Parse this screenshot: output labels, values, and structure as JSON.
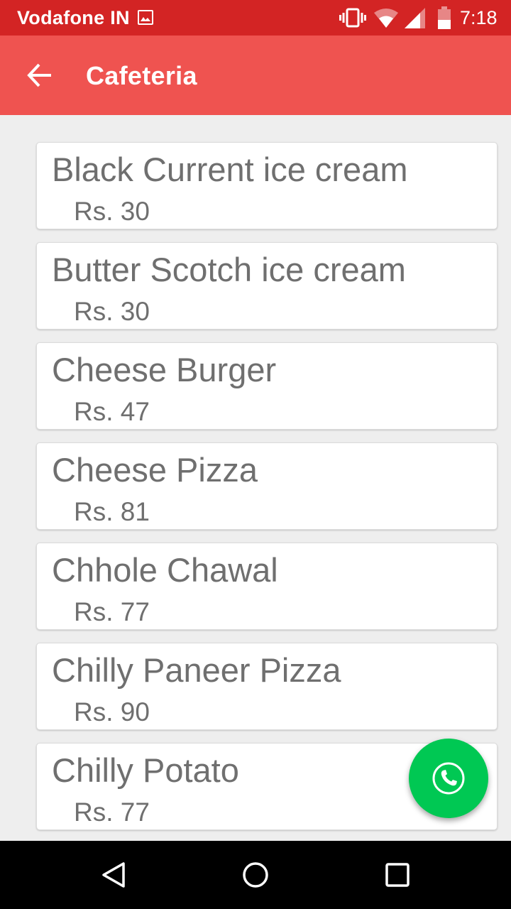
{
  "status_bar": {
    "carrier": "Vodafone IN",
    "time": "7:18",
    "icons": [
      "image-icon",
      "vibrate-icon",
      "wifi-icon",
      "signal-icon",
      "battery-icon"
    ]
  },
  "app_bar": {
    "title": "Cafeteria",
    "back_icon": "arrow-left-icon",
    "color": "#ef5350"
  },
  "menu_items": [
    {
      "name": "Black Current ice cream",
      "price": "Rs. 30"
    },
    {
      "name": "Butter Scotch ice cream",
      "price": "Rs. 30"
    },
    {
      "name": "Cheese Burger",
      "price": "Rs. 47"
    },
    {
      "name": "Cheese Pizza",
      "price": "Rs. 81"
    },
    {
      "name": "Chhole Chawal",
      "price": "Rs. 77"
    },
    {
      "name": "Chilly Paneer Pizza",
      "price": "Rs. 90"
    },
    {
      "name": "Chilly Potato",
      "price": "Rs. 77"
    }
  ],
  "fab": {
    "icon": "phone-icon",
    "color": "#00c853"
  },
  "nav_bar": {
    "icons": [
      "nav-back-icon",
      "nav-home-icon",
      "nav-recents-icon"
    ]
  },
  "colors": {
    "status_bar": "#d32424",
    "text": "#6f6f6f",
    "background": "#eeeeee"
  }
}
